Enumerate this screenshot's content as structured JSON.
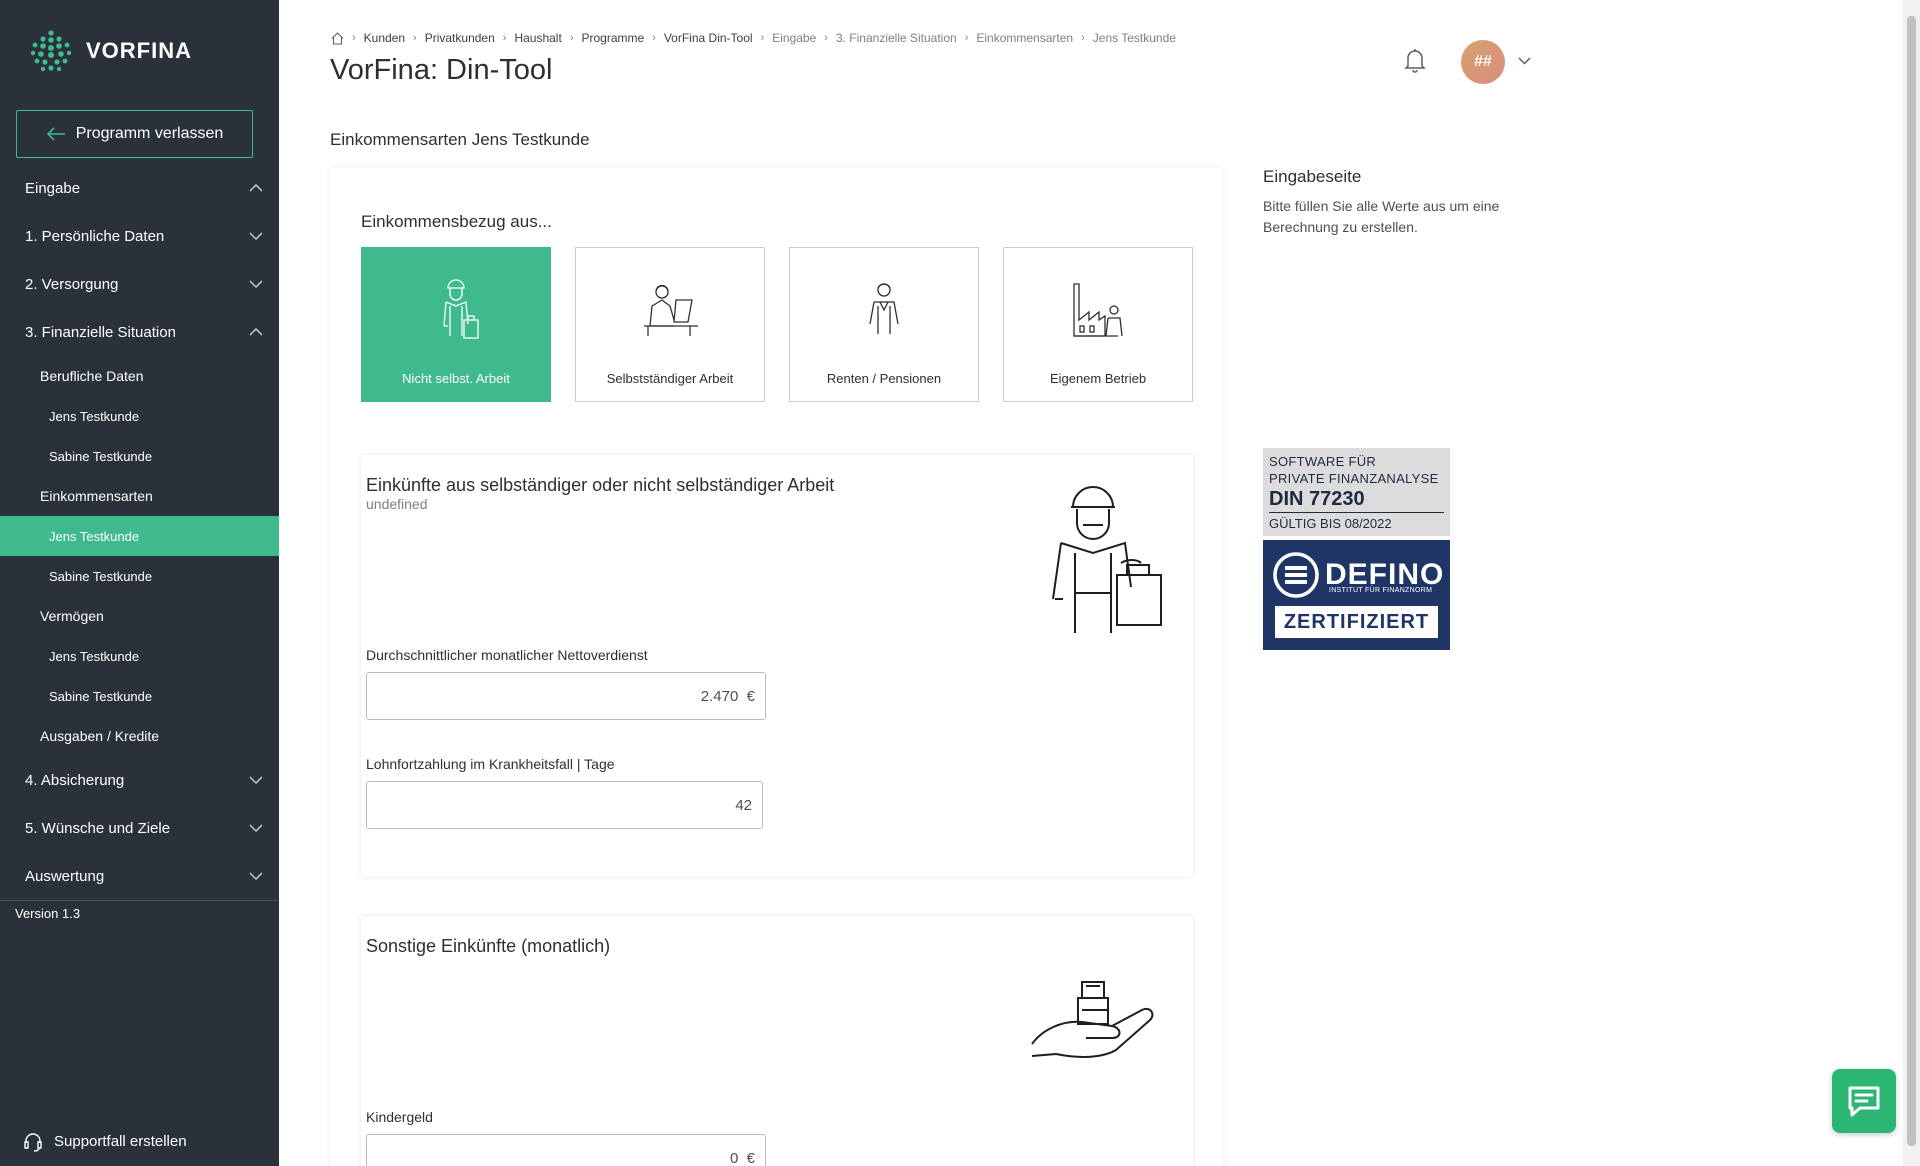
{
  "brand": {
    "name": "VORFINA",
    "accent": "#3fba8c",
    "sidebar_bg": "#2b313a"
  },
  "sidebar": {
    "exit_label": "Programm verlassen",
    "items": [
      {
        "label": "Eingabe",
        "chevron": "up"
      },
      {
        "label": "1. Persönliche Daten",
        "chevron": "down"
      },
      {
        "label": "2. Versorgung",
        "chevron": "down"
      },
      {
        "label": "3. Finanzielle Situation",
        "chevron": "up"
      },
      {
        "label": "Berufliche Daten"
      },
      {
        "label": "Jens Testkunde"
      },
      {
        "label": "Sabine Testkunde"
      },
      {
        "label": "Einkommensarten"
      },
      {
        "label": "Jens Testkunde",
        "active": true
      },
      {
        "label": "Sabine Testkunde"
      },
      {
        "label": "Vermögen"
      },
      {
        "label": "Jens Testkunde"
      },
      {
        "label": "Sabine Testkunde"
      },
      {
        "label": "Ausgaben / Kredite"
      },
      {
        "label": "4. Absicherung",
        "chevron": "down"
      },
      {
        "label": "5. Wünsche und Ziele",
        "chevron": "down"
      },
      {
        "label": "Auswertung",
        "chevron": "down"
      }
    ],
    "version": "Version 1.3",
    "support_label": "Supportfall erstellen"
  },
  "header": {
    "breadcrumb": [
      "Kunden",
      "Privatkunden",
      "Haushalt",
      "Programme",
      "VorFina Din-Tool",
      "Eingabe",
      "3. Finanzielle Situation",
      "Einkommensarten",
      "Jens Testkunde"
    ],
    "title": "VorFina: Din-Tool",
    "avatar_initials": "##"
  },
  "main": {
    "section_heading": "Einkommensarten Jens Testkunde",
    "choose_label": "Einkommensbezug aus...",
    "tiles": [
      {
        "label": "Nicht selbst. Arbeit",
        "selected": true
      },
      {
        "label": "Selbstständiger Arbeit"
      },
      {
        "label": "Renten / Pensionen"
      },
      {
        "label": "Eigenem Betrieb"
      }
    ],
    "card1": {
      "title": "Einkünfte aus selbständiger oder nicht selbständiger Arbeit",
      "description": "undefined",
      "net_label": "Durchschnittlicher monatlicher Nettoverdienst",
      "net_value": "2.470  €",
      "sick_label": "Lohnfortzahlung im Krankheitsfall | Tage",
      "sick_value": "42"
    },
    "card2": {
      "title": "Sonstige Einkünfte (monatlich)",
      "kindergeld_label": "Kindergeld",
      "kindergeld_value": "0  €"
    }
  },
  "info": {
    "title": "Eingabeseite",
    "text": "Bitte füllen Sie alle Werte aus um eine Berechnung zu erstellen."
  },
  "certificate": {
    "line1": "SOFTWARE FÜR",
    "line2": "PRIVATE FINANZANALYSE",
    "din": "DIN 77230",
    "valid": "GÜLTIG BIS 08/2022",
    "org": "DEFINO",
    "org_sub": "INSTITUT FÜR FINANZNORM",
    "status": "ZERTIFIZIERT"
  }
}
